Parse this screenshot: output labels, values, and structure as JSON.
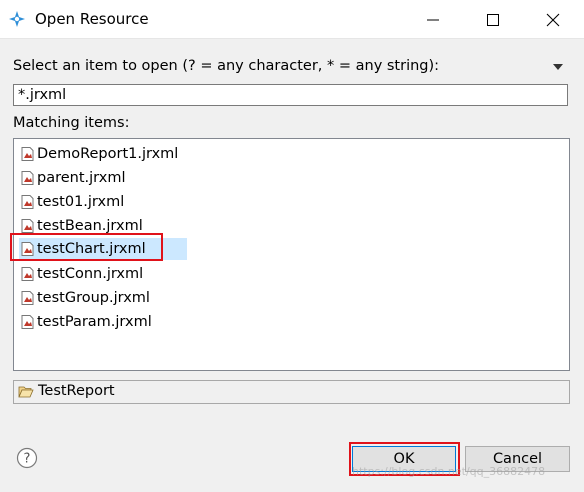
{
  "window": {
    "title": "Open Resource",
    "accent_color": "#cce8ff",
    "highlight_color": "#e0121a"
  },
  "prompt": {
    "label": "Select an item to open (? = any character, * = any string):"
  },
  "filter": {
    "value": "*.jrxml"
  },
  "matching": {
    "label": "Matching items:",
    "items": [
      {
        "label": "DemoReport1.jrxml",
        "icon": "jrxml-file-icon"
      },
      {
        "label": "parent.jrxml",
        "icon": "jrxml-file-icon"
      },
      {
        "label": "test01.jrxml",
        "icon": "jrxml-file-icon"
      },
      {
        "label": "testBean.jrxml",
        "icon": "jrxml-file-icon"
      },
      {
        "label": "testChart.jrxml",
        "icon": "jrxml-file-icon",
        "selected": true
      },
      {
        "label": "testConn.jrxml",
        "icon": "jrxml-file-icon"
      },
      {
        "label": "testGroup.jrxml",
        "icon": "jrxml-file-icon"
      },
      {
        "label": "testParam.jrxml",
        "icon": "jrxml-file-icon"
      }
    ]
  },
  "folder": {
    "label": "TestReport",
    "icon": "open-folder-icon"
  },
  "buttons": {
    "ok": "OK",
    "cancel": "Cancel"
  },
  "watermark": "https://blog.csdn.net/qq_36882478"
}
